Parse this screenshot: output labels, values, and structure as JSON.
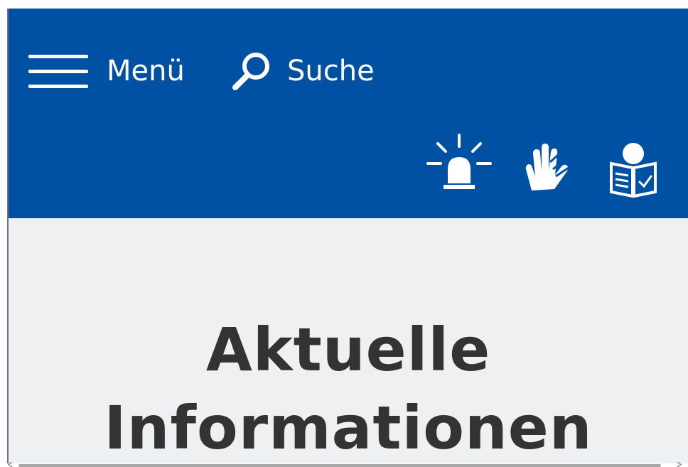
{
  "header": {
    "menu_label": "Menü",
    "search_label": "Suche",
    "background_color": "#0050a3",
    "icons": [
      {
        "name": "alarm-light-icon",
        "meaning": "emergency"
      },
      {
        "name": "sign-language-icon",
        "meaning": "sign language"
      },
      {
        "name": "easy-read-icon",
        "meaning": "easy language"
      }
    ]
  },
  "main": {
    "title": "Aktuelle Informationen",
    "background_color": "#eff0f1",
    "title_color": "#333333"
  }
}
